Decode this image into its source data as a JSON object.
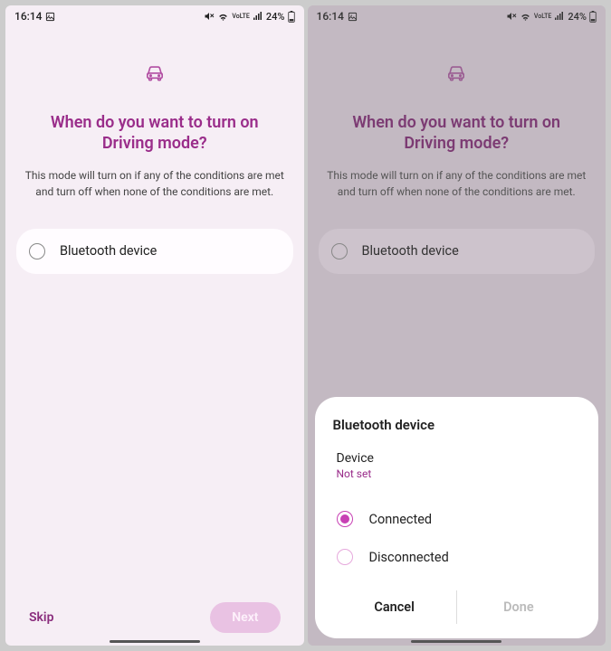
{
  "status": {
    "time": "16:14",
    "battery": "24%"
  },
  "page": {
    "title": "When do you want to turn on Driving mode?",
    "subtitle": "This mode will turn on if any of the conditions are met and turn off when none of the conditions are met.",
    "option": "Bluetooth device"
  },
  "nav": {
    "skip": "Skip",
    "next": "Next"
  },
  "sheet": {
    "title": "Bluetooth device",
    "device_label": "Device",
    "device_value": "Not set",
    "connected": "Connected",
    "disconnected": "Disconnected",
    "cancel": "Cancel",
    "done": "Done"
  }
}
